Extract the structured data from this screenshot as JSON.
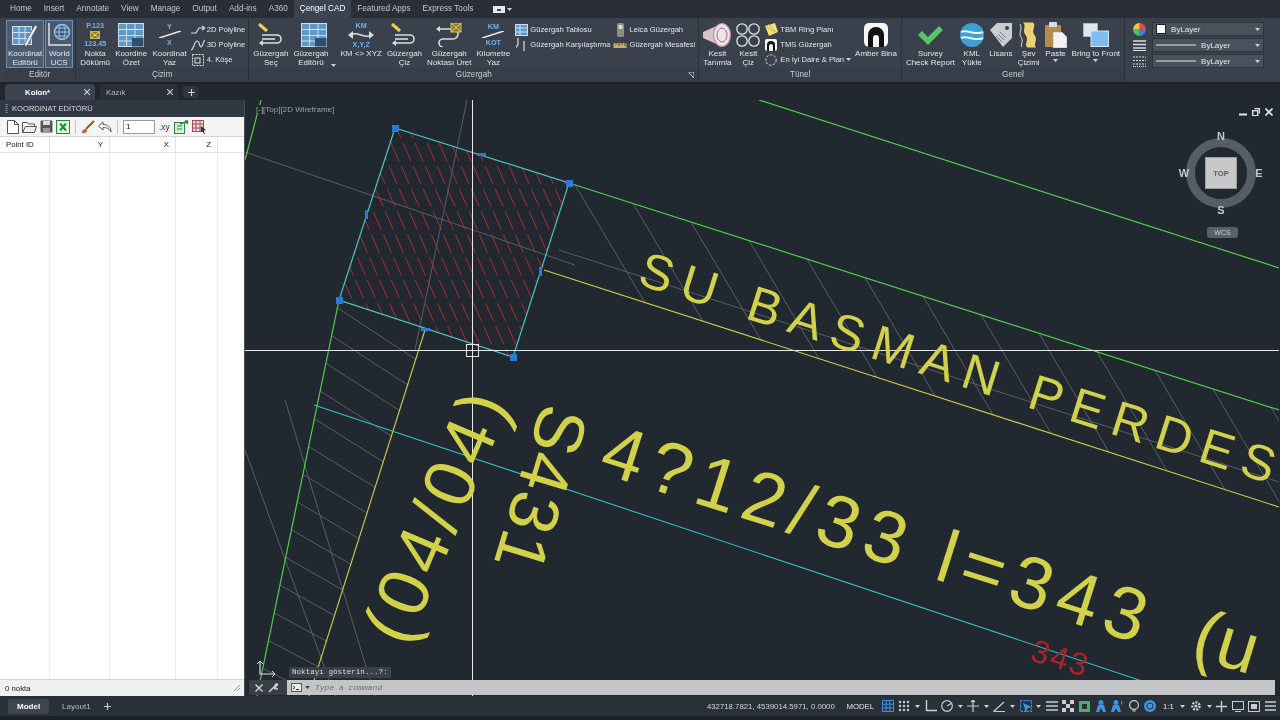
{
  "menu_tabs": [
    {
      "label": "Home",
      "selected": false
    },
    {
      "label": "Insert",
      "selected": false
    },
    {
      "label": "Annotate",
      "selected": false
    },
    {
      "label": "View",
      "selected": false
    },
    {
      "label": "Manage",
      "selected": false
    },
    {
      "label": "Output",
      "selected": false
    },
    {
      "label": "Add-ins",
      "selected": false
    },
    {
      "label": "A360",
      "selected": false
    },
    {
      "label": "Çengel CAD",
      "selected": true
    },
    {
      "label": "Featured Apps",
      "selected": false
    },
    {
      "label": "Express Tools",
      "selected": false
    }
  ],
  "ribbon": {
    "panels": [
      {
        "title": "Editör",
        "items": [
          {
            "kind": "large",
            "label": "Koordinat\nEditörü",
            "active": true
          },
          {
            "kind": "large",
            "label": "World\nUCS",
            "active": true
          }
        ]
      },
      {
        "title": "Çizim",
        "items": [
          {
            "kind": "large",
            "label": "Nokta\nDökümü",
            "icon_text": [
              "P.123",
              "123.45"
            ]
          },
          {
            "kind": "large",
            "label": "Koordine\nÖzet"
          },
          {
            "kind": "large",
            "label": "Koordinat\nYaz",
            "icon_text": [
              "Y",
              "X"
            ]
          },
          {
            "kind": "stack",
            "items": [
              {
                "label": "2D Polyline"
              },
              {
                "label": "3D Polyline"
              },
              {
                "label": "4. Köşe"
              }
            ]
          }
        ]
      },
      {
        "title": "Güzergah",
        "launcher": true,
        "items": [
          {
            "kind": "large",
            "label": "Güzergah\nSeç",
            "dropdown": false
          },
          {
            "kind": "large",
            "label": "Güzergah\nEditörü",
            "dropdown": true
          },
          {
            "kind": "large",
            "label": "KM <> XYZ",
            "icon_text": [
              "KM",
              "X,Y,Z"
            ],
            "dropdown": false
          },
          {
            "kind": "large",
            "label": "Güzergah\nÇiz",
            "dropdown": false
          },
          {
            "kind": "large",
            "label": "Güzergah\nNoktası Üret",
            "dropdown": false
          },
          {
            "kind": "large",
            "label": "Kilometre\nYaz",
            "icon_text": [
              "KM",
              "KOT"
            ],
            "dropdown": false
          },
          {
            "kind": "stack",
            "items": [
              {
                "label": "Güzergah Tablosu"
              },
              {
                "label": "Güzergah Karşılaştırma"
              }
            ]
          },
          {
            "kind": "stack",
            "items": [
              {
                "label": "Leica Güzergah"
              },
              {
                "label": "Güzergah Mesafesi"
              }
            ]
          }
        ]
      },
      {
        "title": "Tünel",
        "items": [
          {
            "kind": "large",
            "label": "Kesit\nTanımla"
          },
          {
            "kind": "large",
            "label": "Kesit\nÇiz"
          },
          {
            "kind": "stack",
            "items": [
              {
                "label": "TBM Ring Planı",
                "dropdown": false
              },
              {
                "label": "TMS Güzergah",
                "dropdown": false
              },
              {
                "label": "En İyi Daire & Plan",
                "dropdown": true
              }
            ]
          },
          {
            "kind": "large",
            "label": "Amber Bina"
          }
        ]
      },
      {
        "title": "Genel",
        "items": [
          {
            "kind": "large",
            "label": "Survey\nCheck Report",
            "dropdown": false
          },
          {
            "kind": "large",
            "label": "KML\nYükle",
            "dropdown": false
          },
          {
            "kind": "large",
            "label": "Lisans",
            "dropdown": false
          },
          {
            "kind": "large",
            "label": "Şev\nÇizimi",
            "dropdown": false
          },
          {
            "kind": "large",
            "label": "Paste",
            "dropdown": true
          },
          {
            "kind": "large",
            "label": "Bring to Front",
            "dropdown": true
          }
        ]
      }
    ],
    "properties": [
      {
        "kind": "color",
        "value": "ByLayer",
        "color": "#ffffff"
      },
      {
        "kind": "lineweight",
        "value": "ByLayer"
      },
      {
        "kind": "linetype",
        "value": "ByLayer"
      }
    ]
  },
  "doc_tabs": [
    {
      "label": "Kolon*",
      "selected": true
    },
    {
      "label": "Kazık",
      "selected": false
    }
  ],
  "left_panel": {
    "title": "KOORDINAT EDİTÖRÜ",
    "toolbar_input": {
      "value": "1"
    },
    "xy_label": ".xy",
    "columns": [
      "Point ID",
      "Y",
      "X",
      "Z"
    ],
    "footer": "0 nokta"
  },
  "viewport": {
    "view_label": "[-][Top][2D Wireframe]",
    "compass": {
      "north": "N",
      "east": "E",
      "south": "S",
      "west": "W",
      "face": "TOP",
      "ucs": "WCS"
    },
    "drawing_texts": [
      {
        "text": "SU BASMAN PERDES",
        "color": "#d2d24a"
      },
      {
        "text": "S431",
        "color": "#d2d24a"
      },
      {
        "text": "(04/04)",
        "color": "#d2d24a"
      },
      {
        "text": "4?12/33 l=343",
        "color": "#d2d24a"
      },
      {
        "text": "(u",
        "color": "#d2d24a"
      },
      {
        "text": "343",
        "color": "#a8242a"
      }
    ]
  },
  "command_line": {
    "prompt": "Noktayı gösterin...?:",
    "placeholder": "Type a command"
  },
  "layout_tabs": [
    {
      "label": "Model",
      "selected": true
    },
    {
      "label": "Layout1",
      "selected": false
    }
  ],
  "status_bar": {
    "coordinates": "432718.7821, 4539014.5971, 0.0000",
    "space": "MODEL",
    "toggles": [
      {
        "on": true
      },
      {
        "on": false
      },
      {
        "on": false
      },
      {
        "on": false
      },
      {
        "on": false
      },
      {
        "on": false
      },
      {
        "on": true
      },
      {
        "on": false
      },
      {
        "on": false
      },
      {
        "on": true
      },
      {
        "on": true
      },
      {
        "on": false
      },
      {
        "on": true
      }
    ],
    "scale": "1:1"
  }
}
